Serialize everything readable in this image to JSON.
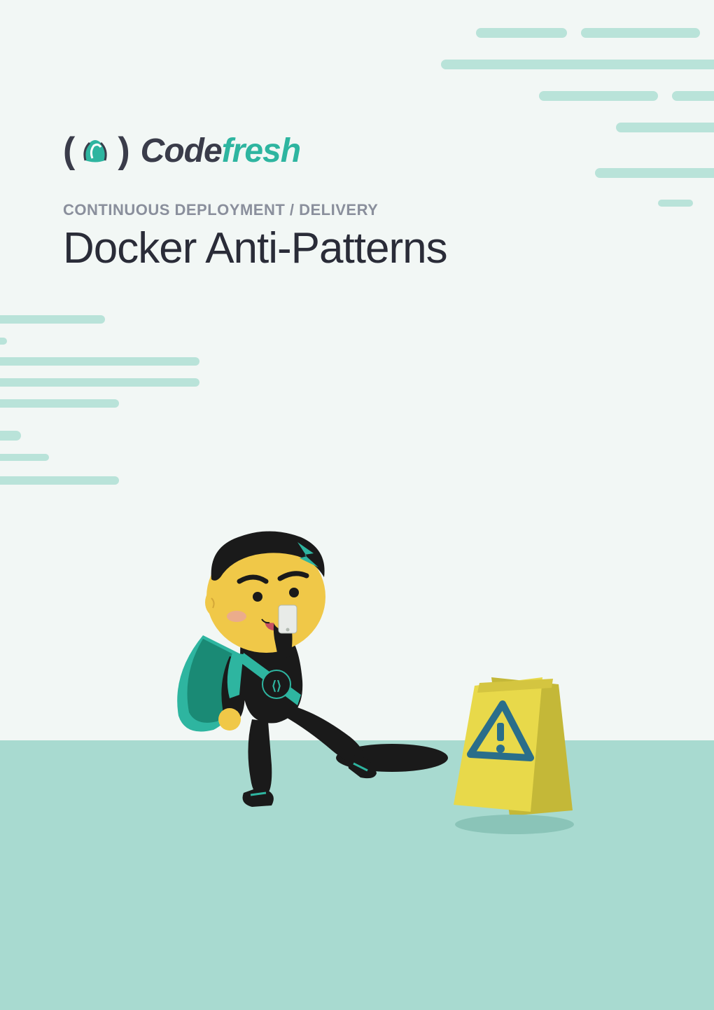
{
  "brand": {
    "name_part1": "Code",
    "name_part2": "fresh"
  },
  "header": {
    "subtitle": "CONTINUOUS DEPLOYMENT / DELIVERY",
    "title": "Docker Anti-Patterns"
  },
  "colors": {
    "accent": "#2eb5a0",
    "ground": "#a8dad0",
    "stripe": "#b9e3d9",
    "text_dark": "#3a3c4a",
    "warning": "#e8d94a"
  }
}
